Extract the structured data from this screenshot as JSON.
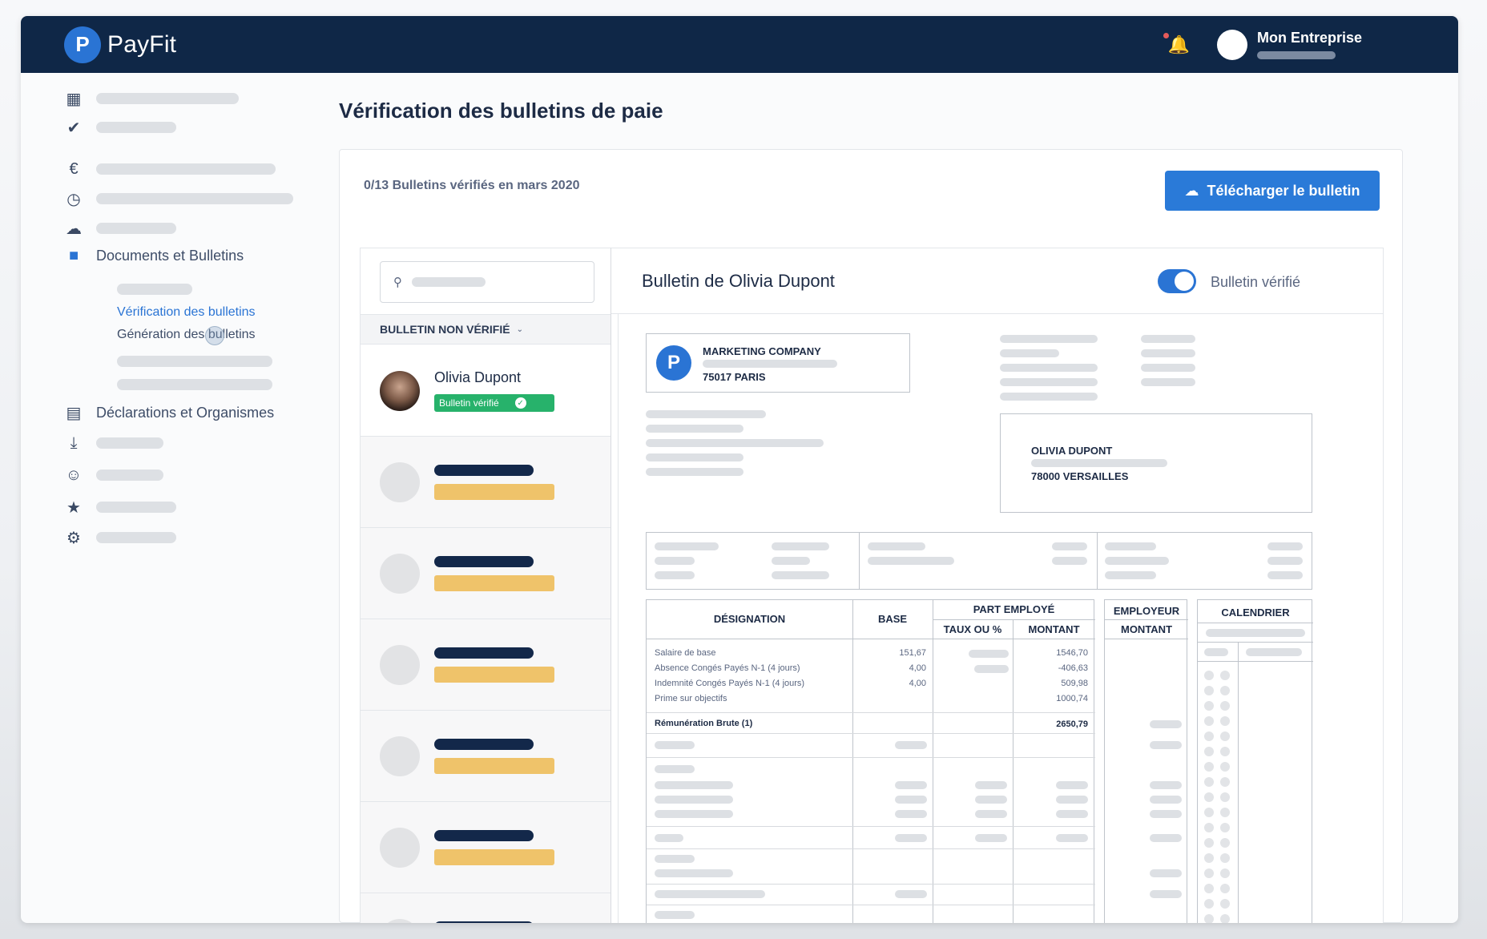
{
  "app": {
    "name": "PayFit",
    "logo_letter": "P"
  },
  "topbar": {
    "company": "Mon Entreprise",
    "bell_icon": "bell-icon"
  },
  "sidebar": {
    "documents_label": "Documents et Bulletins",
    "verification_link": "Vérification des bulletins",
    "generation_link": "Génération des bulletins",
    "declarations_label": "Déclarations et Organismes"
  },
  "page": {
    "title": "Vérification des bulletins de paie",
    "status": "0/13 Bulletins vérifiés en mars 2020",
    "download_label": "Télécharger le bulletin"
  },
  "list": {
    "filter_label": "BULLETIN NON VÉRIFIÉ",
    "items": [
      {
        "name": "Olivia Dupont",
        "badge": "Bulletin vérifié"
      }
    ]
  },
  "detail": {
    "title": "Bulletin de Olivia Dupont",
    "toggle_label": "Bulletin vérifié",
    "company_name": "MARKETING COMPANY",
    "company_city": "75017 PARIS",
    "employee_name": "OLIVIA DUPONT",
    "employee_city": "78000 VERSAILLES"
  },
  "payslip": {
    "headers": {
      "designation": "DÉSIGNATION",
      "base": "BASE",
      "part_employe": "PART EMPLOYÉ",
      "taux": "TAUX OU %",
      "montant": "MONTANT",
      "employeur": "EMPLOYEUR",
      "employeur_montant": "MONTANT",
      "calendrier": "CALENDRIER"
    },
    "rows": [
      {
        "label": "Salaire de base",
        "base": "151,67",
        "montant": "1546,70"
      },
      {
        "label": "Absence Congés Payés N-1 (4 jours)",
        "base": "4,00",
        "montant": "-406,63"
      },
      {
        "label": "Indemnité Congés Payés N-1 (4 jours)",
        "base": "4,00",
        "montant": "509,98"
      },
      {
        "label": "Prime sur objectifs",
        "base": "",
        "montant": "1000,74"
      }
    ],
    "gross_label": "Rémunération Brute (1)",
    "gross_value": "2650,79"
  }
}
